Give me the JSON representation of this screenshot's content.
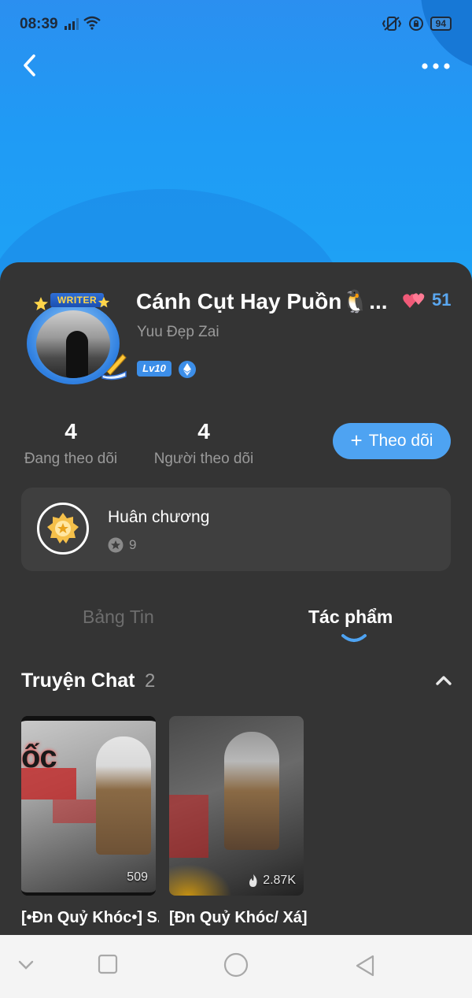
{
  "status_bar": {
    "time": "08:39",
    "battery": "94"
  },
  "header": {
    "back_icon": "chevron-left-icon",
    "more_icon": "more-dots-icon",
    "accent_color": "#1f9bf5"
  },
  "profile": {
    "badge_text": "WRITER",
    "name": "Cánh Cụt Hay Puồn🐧...",
    "username": "Yuu Đẹp Zai",
    "level": "Lv10",
    "likes_count": "51"
  },
  "stats": {
    "following_count": "4",
    "following_label": "Đang theo dõi",
    "followers_count": "4",
    "followers_label": "Người theo dõi",
    "follow_button": "Theo dõi"
  },
  "medal": {
    "title": "Huân chương",
    "count": "9"
  },
  "tabs": [
    {
      "label": "Bảng Tin",
      "active": false
    },
    {
      "label": "Tác phẩm",
      "active": true
    }
  ],
  "section": {
    "title": "Truyện Chat",
    "count": "2"
  },
  "cards": [
    {
      "art_text": "ốc",
      "views": "509",
      "title": "[•Đn Quỷ Khóc•] S..."
    },
    {
      "views": "2.87K",
      "title": "[Đn Quỷ Khóc/ Xá] Dương Ch..."
    }
  ],
  "colors": {
    "sheet_bg": "#343434",
    "follow_button_bg": "#4ea3f2",
    "likes_color": "#5aa7f0"
  }
}
